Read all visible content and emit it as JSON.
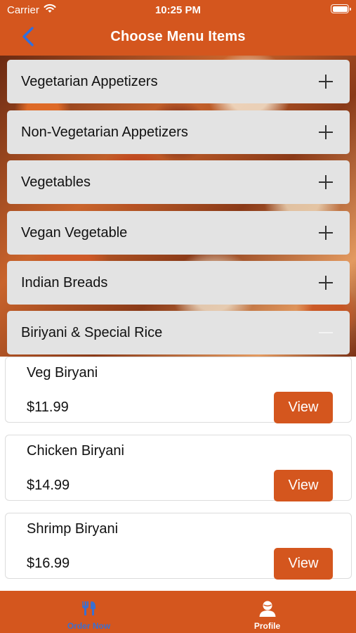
{
  "status_bar": {
    "carrier": "Carrier",
    "time": "10:25 PM"
  },
  "nav": {
    "title": "Choose Menu Items"
  },
  "categories": [
    {
      "label": "Vegetarian Appetizers",
      "expanded": false
    },
    {
      "label": "Non-Vegetarian Appetizers",
      "expanded": false
    },
    {
      "label": "Vegetables",
      "expanded": false
    },
    {
      "label": "Vegan Vegetable",
      "expanded": false
    },
    {
      "label": "Indian Breads",
      "expanded": false
    },
    {
      "label": "Biriyani & Special Rice",
      "expanded": true
    }
  ],
  "items": [
    {
      "name": "Veg Biryani",
      "price": "$11.99",
      "button": "View"
    },
    {
      "name": "Chicken Biryani",
      "price": "$14.99",
      "button": "View"
    },
    {
      "name": "Shrimp Biryani",
      "price": "$16.99",
      "button": "View"
    }
  ],
  "tabs": {
    "order_now": {
      "label": "Order Now",
      "icon": "utensils-icon",
      "active": true
    },
    "profile": {
      "label": "Profile",
      "icon": "user-icon",
      "active": false
    }
  },
  "colors": {
    "accent": "#d4561e",
    "active_tab": "#3b6fd0",
    "back_arrow": "#2f6fe0"
  }
}
